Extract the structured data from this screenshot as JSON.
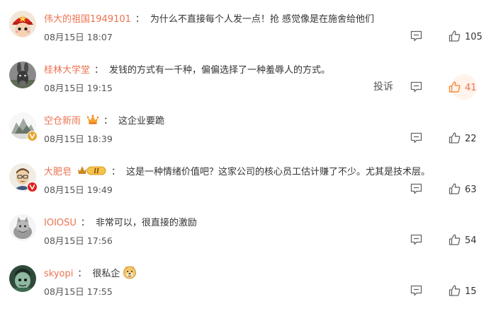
{
  "colors": {
    "username": "#eb7350",
    "text": "#333333",
    "meta": "#555555",
    "accent": "#f78a3a",
    "vip": "#e8a531",
    "verified": "#e8a531",
    "verified_red": "#e0201b"
  },
  "comments": [
    {
      "username": "伟大的祖国1949101",
      "separator": "：",
      "text": "为什么不直接每个人发一点！抢 感觉像是在施舍给他们",
      "time": "08月15日 18:07",
      "likes": "105",
      "avatar_icon": "cartoon-red-hat-avatar",
      "badge": "",
      "report": "",
      "liked": false
    },
    {
      "username": "桂林大学堂",
      "separator": "：",
      "text": "发钱的方式有一千种，偏偏选择了一种羞辱人的方式。",
      "time": "08月15日 19:15",
      "likes": "41",
      "avatar_icon": "donkey-avatar",
      "badge": "",
      "report": "投诉",
      "liked": true
    },
    {
      "username": "空仓新雨",
      "separator": "：",
      "text": "这企业要跪",
      "time": "08月15日 18:39",
      "likes": "22",
      "avatar_icon": "mountain-avatar",
      "badge": "crown-icon",
      "report": "",
      "liked": false
    },
    {
      "username": "大肥皂",
      "separator": "：",
      "text": "这是一种情绪价值吧？这家公司的核心员工估计赚了不少。尤其是技术层。",
      "time": "08月15日 19:49",
      "likes": "63",
      "avatar_icon": "man-glasses-avatar",
      "badge": "vip-level-badge",
      "badge_text": "II",
      "report": "",
      "liked": false
    },
    {
      "username": "IOIOSU",
      "separator": "：",
      "text": "非常可以，很直接的激励",
      "time": "08月15日 17:56",
      "likes": "54",
      "avatar_icon": "cat-avatar",
      "badge": "",
      "report": "",
      "liked": false
    },
    {
      "username": "skyopi",
      "separator": "：",
      "text": "很私企",
      "time": "08月15日 17:55",
      "likes": "15",
      "avatar_icon": "character-avatar",
      "badge": "",
      "emoji": "doge-emoji",
      "report": "",
      "liked": false
    }
  ]
}
